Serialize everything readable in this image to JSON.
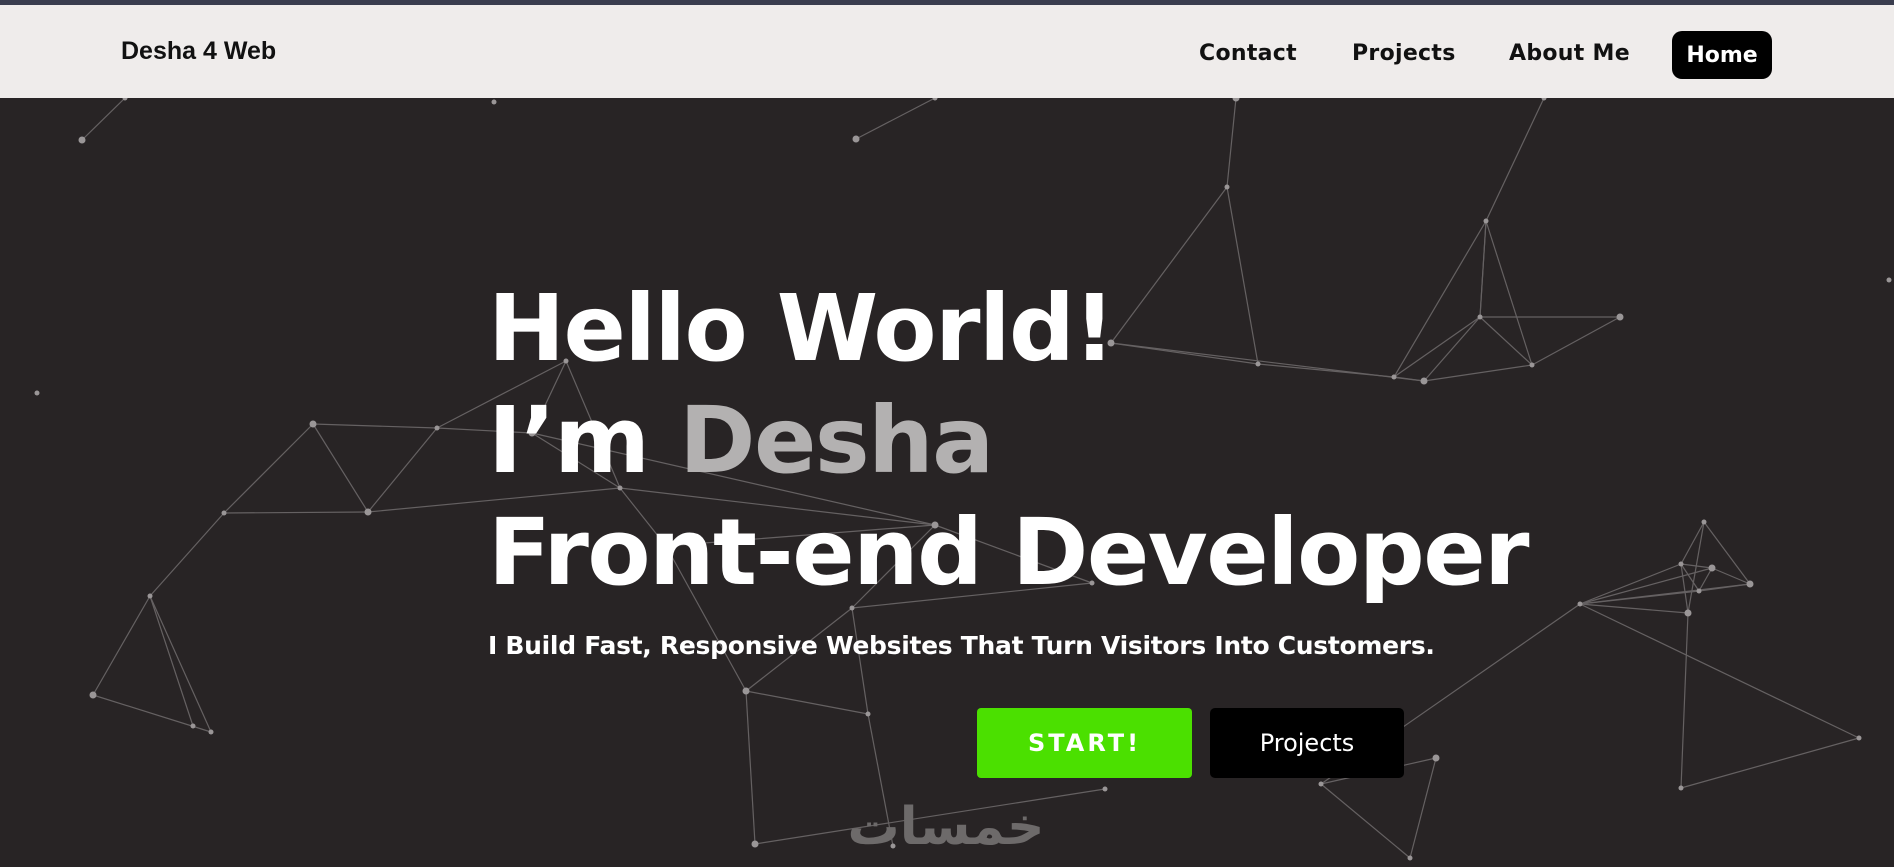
{
  "nav": {
    "logo": "Desha 4 Web",
    "links": {
      "contact": "Contact",
      "projects": "Projects",
      "about": "About Me",
      "home": "Home"
    }
  },
  "hero": {
    "line1": "Hello World!",
    "line2_prefix": "I’m ",
    "line2_name": "Desha",
    "line3": "Front-end Developer",
    "subtitle": "I Build Fast, Responsive Websites That Turn Visitors Into Customers.",
    "start_label": "START!",
    "projects_label": "Projects"
  },
  "watermark": {
    "text": "خمسات"
  },
  "colors": {
    "background": "#282425",
    "navbar": "#efeceb",
    "accent_green": "#4be000",
    "name_gray": "#b3b1b1",
    "top_strip": "#3a3d4e"
  },
  "icons": {
    "background": "particle-network-icon",
    "watermark": "khamsat-logo"
  }
}
